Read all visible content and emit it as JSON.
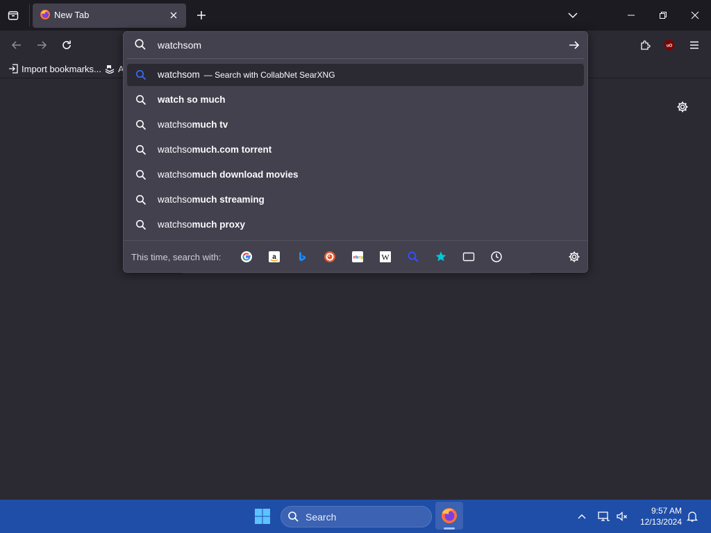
{
  "tab": {
    "title": "New Tab",
    "close_icon": "close-icon"
  },
  "window_controls": {
    "minimize": "minimize-icon",
    "restore": "restore-icon",
    "close": "close-icon"
  },
  "bookmarks": {
    "import_label": "Import bookmarks...",
    "second_label": "A"
  },
  "urlbar": {
    "value": "watchsom",
    "results": [
      {
        "icon": "search-icon",
        "plain": "watchsom",
        "bold": "",
        "action": "— Search with CollabNet SearXNG",
        "selected": true
      },
      {
        "icon": "search-icon",
        "plain": "",
        "bold": "watch so much",
        "action": "",
        "selected": false
      },
      {
        "icon": "search-icon",
        "plain": "watchso",
        "bold": "much tv",
        "action": "",
        "selected": false
      },
      {
        "icon": "search-icon",
        "plain": "watchso",
        "bold": "much.com torrent",
        "action": "",
        "selected": false
      },
      {
        "icon": "search-icon",
        "plain": "watchso",
        "bold": "much download movies",
        "action": "",
        "selected": false
      },
      {
        "icon": "search-icon",
        "plain": "watchso",
        "bold": "much streaming",
        "action": "",
        "selected": false
      },
      {
        "icon": "search-icon",
        "plain": "watchso",
        "bold": "much proxy",
        "action": "",
        "selected": false
      }
    ],
    "one_off_label": "This time, search with:",
    "engines": [
      "google",
      "amazon",
      "bing",
      "duckduckgo",
      "ebay",
      "wikipedia",
      "searxng",
      "bookmarks",
      "tabs",
      "history"
    ]
  },
  "taskbar": {
    "search_label": "Search",
    "time": "9:57 AM",
    "date": "12/13/2024"
  },
  "colors": {
    "accent": "#0061e0",
    "taskbar": "#1f4ea8",
    "panel": "#42414d",
    "page": "#2b2a33"
  }
}
